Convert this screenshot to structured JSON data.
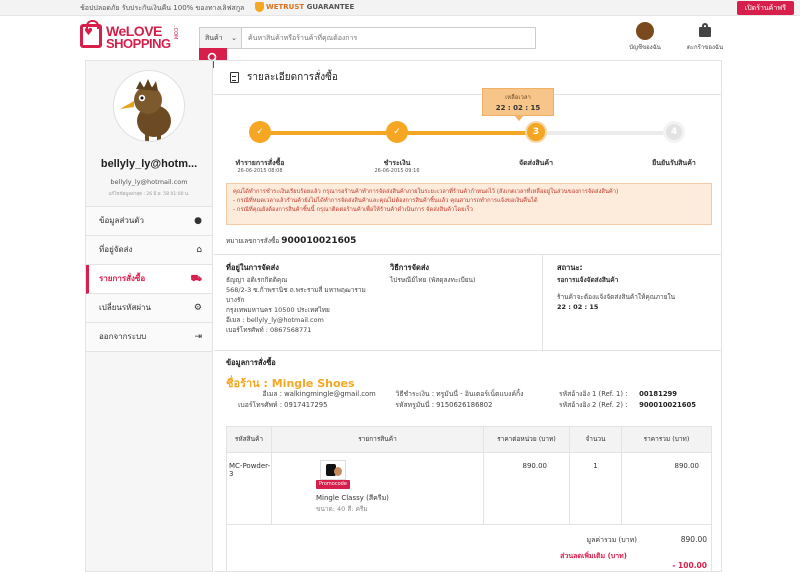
{
  "topbar": {
    "promo": "ช้อปปลอดภัย รับประกันเงินคืน 100% ของทางเลิฟสกูล",
    "trust_brand": "WETRUST",
    "trust_word": "GUARANTEE",
    "shop_button": "เปิดร้านค้าฟรี"
  },
  "header": {
    "logo_line1": "WeLOVE",
    "logo_line2": "SHOPPING",
    "logo_suffix": ".COM",
    "search_category": "สินค้า",
    "search_placeholder": "ค้นหาสินค้าหรือร้านค้าที่คุณต้องการ",
    "account_label": "บัญชีของฉัน",
    "cart_label": "ตะกร้าของฉัน"
  },
  "sidebar": {
    "username": "bellyly_ly@hotm...",
    "email": "bellyly_ly@hotmail.com",
    "last_login": "แก้ไขข้อมูลล่าสุด : 26 มิ.ย. 58 01:00 น.",
    "menu": [
      {
        "label": "ข้อมูลส่วนตัว",
        "icon": "user-icon",
        "glyph": "👤",
        "active": false
      },
      {
        "label": "ที่อยู่จัดส่ง",
        "icon": "home-icon",
        "glyph": "⌂",
        "active": false
      },
      {
        "label": "รายการสั่งซื้อ",
        "icon": "cart-icon",
        "glyph": "🛒",
        "active": true
      },
      {
        "label": "เปลี่ยนรหัสผ่าน",
        "icon": "gear-icon",
        "glyph": "⚙",
        "active": false
      },
      {
        "label": "ออกจากระบบ",
        "icon": "logout-icon",
        "glyph": "⏏",
        "active": false
      }
    ]
  },
  "main": {
    "page_title": "รายละเอียดการสั่งซื้อ",
    "timer_label": "เหลือเวลา",
    "timer_value": "22 : 02 : 15",
    "steps": [
      {
        "label": "ทำรายการสั่งซื้อ",
        "date": "26-06-2015 08:08",
        "state": "done",
        "mark": "✓"
      },
      {
        "label": "ชำระเงิน",
        "date": "26-06-2015 09:16",
        "state": "done",
        "mark": "✓"
      },
      {
        "label": "จัดส่งสินค้า",
        "date": "",
        "state": "current",
        "mark": "3"
      },
      {
        "label": "ยืนยันรับสินค้า",
        "date": "",
        "state": "todo",
        "mark": "4"
      }
    ],
    "notice_lines": [
      "คุณได้ทำการชำระเงินเรียบร้อยแล้ว กรุณารอร้านค้าทำการจัดส่งสินค้าภายในระยะเวลาที่ร้านค้ากำหนดไว้ (สังเกตเวลาที่เหลืออยู่ในส่วนของการจัดส่งสินค้า)",
      "- กรณีที่หมดเวลาแล้วร้านค้ายังไม่ได้ทำการจัดส่งสินค้าและคุณไม่ต้องการสินค้าชิ้นแล้ว คุณสามารถทำการแจ้งขอเงินคืนได้",
      "- กรณีที่คุณยังต้องการสินค้าชิ้นนี้ กรุณาติดต่อร้านค้าเพื่อให้ร้านค้าดำเนินการ จัดส่งสินค้าโดยเร็ว"
    ],
    "order_no_label": "หมายเลขการสั่งซื้อ",
    "order_no": "900010021605",
    "address": {
      "heading": "ที่อยู่ในการจัดส่ง",
      "lines": [
        "ธัญญา อดิเรกกิตติคุณ",
        "568/2-3 ซ.ก้าพรานิช ถ.พระรามสี่ มหาพฤฒาราม",
        "บางรัก",
        "กรุงเทพมหานคร 10500 ประเทศไทย",
        "อีเมล : bellyly_ly@hotmail.com",
        "เบอร์โทรศัพท์ : 0867568771"
      ]
    },
    "shipping": {
      "heading": "วิธีการจัดส่ง",
      "method": "ไปรษณีย์ไทย (พัสดุลงทะเบียน)"
    },
    "status": {
      "heading": "สถานะ:",
      "value": "รอการแจ้งจัดส่งสินค้า",
      "note": "ร้านค้าจะต้องแจ้งจัดส่งสินค้าให้คุณภายใน",
      "time": "22 : 02 : 15"
    },
    "order_info_heading": "ข้อมูลการสั่งซื้อ",
    "shop_label": "ชื่อร้าน : Mingle Shoes",
    "shop_email_label": "อีเมล :",
    "shop_email": "walkingmingle@gmail.com",
    "shop_phone_label": "เบอร์โทรศัพท์ :",
    "shop_phone": "0917417295",
    "payment_label": "วิธีชำระเงิน :",
    "payment_value": "ทรูมันนี่ - อินเตอร์เน็ตแบงค์กิ้ง",
    "txn_label": "รหัสทรูมันนี่ :",
    "txn_value": "9150626186802",
    "ref1_label": "รหัสอ้างอิง 1 (Ref. 1) :",
    "ref1_value": "00181299",
    "ref2_label": "รหัสอ้างอิง 2 (Ref. 2) :",
    "ref2_value": "900010021605"
  },
  "table": {
    "headers": [
      "รหัสสินค้า",
      "รายการสินค้า",
      "ราคาต่อหน่วย (บาท)",
      "จำนวน",
      "ราคารวม (บาท)"
    ],
    "rows": [
      {
        "sku": "MC-Powder-3",
        "promo_tag": "Promocode",
        "name": "Mingle Classy (สีครีม)",
        "size": "ขนาด: 40 สี: ครีม",
        "unit_price": "890.00",
        "qty": "1",
        "total": "890.00"
      }
    ]
  },
  "summary": {
    "subtotal_label": "มูลค่ารวม (บาท)",
    "subtotal_value": "890.00",
    "discount_label": "ส่วนลดเพิ่มเติม (บาท)",
    "discount_value": "- 100.00"
  }
}
